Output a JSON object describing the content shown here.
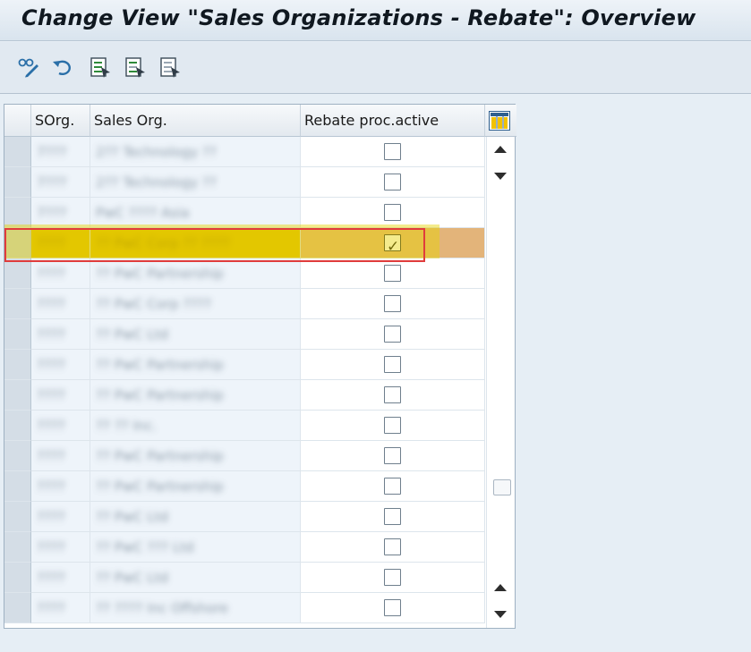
{
  "window": {
    "title": "Change View \"Sales Organizations - Rebate\": Overview"
  },
  "toolbar": {
    "buttons": [
      {
        "name": "display-change-icon"
      },
      {
        "name": "undo-icon"
      },
      {
        "name": "select-all-icon"
      },
      {
        "name": "select-block-icon"
      },
      {
        "name": "deselect-all-icon"
      }
    ]
  },
  "table": {
    "columns": [
      "SOrg.",
      "Sales Org.",
      "Rebate proc.active"
    ],
    "rows": [
      {
        "sorg": "7???",
        "name": "2?? Technology ??",
        "active": false
      },
      {
        "sorg": "7???",
        "name": "2?? Technology ??",
        "active": false
      },
      {
        "sorg": "7???",
        "name": "PwC ???? Asia",
        "active": false
      },
      {
        "sorg": "????",
        "name": "?? PwC Corp ?? ????",
        "active": true
      },
      {
        "sorg": "????",
        "name": "?? PwC Partnership",
        "active": false
      },
      {
        "sorg": "????",
        "name": "?? PwC Corp ????",
        "active": false
      },
      {
        "sorg": "????",
        "name": "?? PwC Ltd",
        "active": false
      },
      {
        "sorg": "????",
        "name": "?? PwC Partnership",
        "active": false
      },
      {
        "sorg": "????",
        "name": "?? PwC Partnership",
        "active": false
      },
      {
        "sorg": "????",
        "name": "?? ?? Inc.",
        "active": false
      },
      {
        "sorg": "????",
        "name": "?? PwC Partnership",
        "active": false
      },
      {
        "sorg": "????",
        "name": "?? PwC Partnership",
        "active": false
      },
      {
        "sorg": "????",
        "name": "?? PwC Ltd",
        "active": false
      },
      {
        "sorg": "????",
        "name": "?? PwC ??? Ltd",
        "active": false
      },
      {
        "sorg": "????",
        "name": "?? PwC Ltd",
        "active": false
      },
      {
        "sorg": "????",
        "name": "?? ???? Inc Offshore",
        "active": false
      }
    ],
    "highlighted_row": 3
  },
  "colors": {
    "highlight": "#e0bd00",
    "annotation": "#e03c3c"
  }
}
